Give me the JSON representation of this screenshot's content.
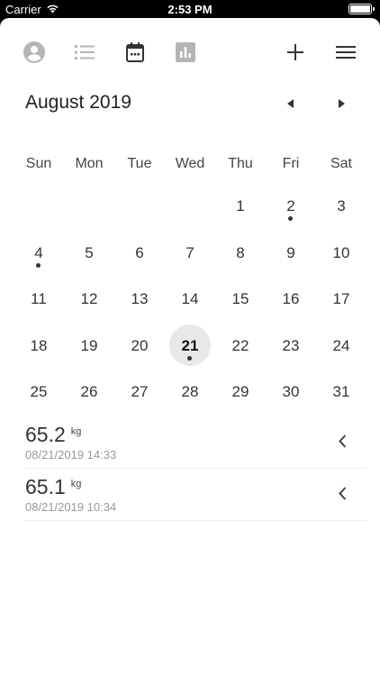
{
  "status_bar": {
    "carrier": "Carrier",
    "time": "2:53 PM",
    "battery_level": 1.0
  },
  "toolbar": {
    "icons": [
      "account-icon",
      "list-icon",
      "calendar-icon",
      "bar-chart-icon",
      "plus-icon",
      "menu-icon"
    ],
    "active_icon": "calendar-icon",
    "active_color": "#333333",
    "inactive_color": "#b5b5b5"
  },
  "calendar": {
    "month_title": "August 2019",
    "weekdays": [
      "Sun",
      "Mon",
      "Tue",
      "Wed",
      "Thu",
      "Fri",
      "Sat"
    ],
    "weeks": [
      [
        "",
        "",
        "",
        "",
        "1",
        "2",
        "3"
      ],
      [
        "4",
        "5",
        "6",
        "7",
        "8",
        "9",
        "10"
      ],
      [
        "11",
        "12",
        "13",
        "14",
        "15",
        "16",
        "17"
      ],
      [
        "18",
        "19",
        "20",
        "21",
        "22",
        "23",
        "24"
      ],
      [
        "25",
        "26",
        "27",
        "28",
        "29",
        "30",
        "31"
      ]
    ],
    "days_with_entries": [
      "2",
      "4",
      "21"
    ],
    "selected_day": "21"
  },
  "entries": [
    {
      "weight": "65.2",
      "unit": "kg",
      "timestamp": "08/21/2019 14:33"
    },
    {
      "weight": "65.1",
      "unit": "kg",
      "timestamp": "08/21/2019 10:34"
    }
  ]
}
